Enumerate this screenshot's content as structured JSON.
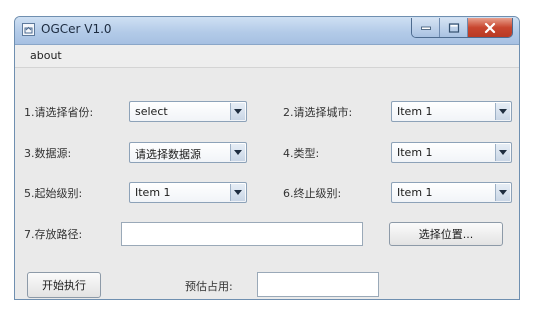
{
  "window": {
    "title": "OGCer V1.0"
  },
  "menu": {
    "items": [
      "about"
    ]
  },
  "form": {
    "province": {
      "label": "1.请选择省份:",
      "value": "select"
    },
    "city": {
      "label": "2.请选择城市:",
      "value": "Item 1"
    },
    "source": {
      "label": "3.数据源:",
      "value": "请选择数据源"
    },
    "type": {
      "label": "4.类型:",
      "value": "Item 1"
    },
    "start_level": {
      "label": "5.起始级别:",
      "value": "Item 1"
    },
    "end_level": {
      "label": "6.终止级别:",
      "value": "Item 1"
    },
    "path": {
      "label": "7.存放路径:",
      "value": "",
      "browse_label": "选择位置..."
    },
    "start_button": "开始执行",
    "estimate": {
      "label": "预估占用:",
      "value": ""
    }
  },
  "icons": {
    "app": "window-app-icon",
    "minimize": "minimize-icon",
    "maximize": "maximize-icon",
    "close": "close-icon",
    "dropdown": "chevron-down-icon"
  },
  "colors": {
    "titlebar": "#b3cbe8",
    "close_button": "#c8462f",
    "window_bg": "#eaeaea"
  }
}
